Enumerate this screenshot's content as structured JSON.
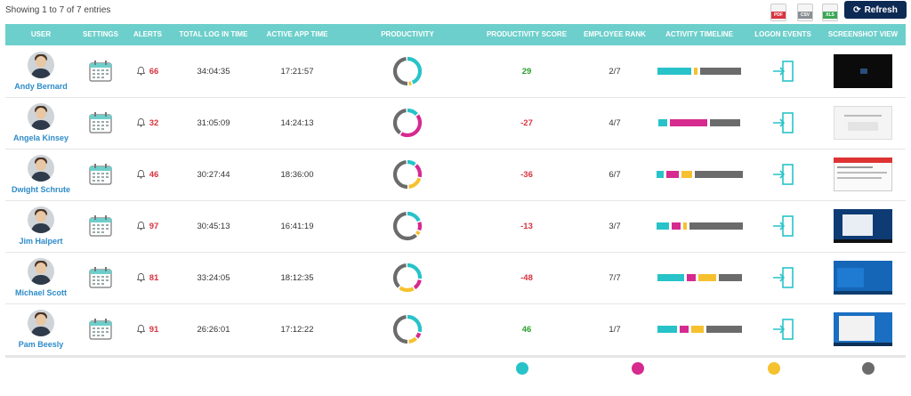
{
  "entries_text": "Showing 1 to 7 of 7 entries",
  "exports": [
    {
      "icon": "pdf-icon",
      "label": "PDF",
      "color": "#d9333f"
    },
    {
      "icon": "csv-icon",
      "label": "CSV",
      "color": "#8a8f95"
    },
    {
      "icon": "xls-icon",
      "label": "XLS",
      "color": "#3aa655"
    }
  ],
  "refresh_label": "Refresh",
  "columns": [
    "USER",
    "SETTINGS",
    "ALERTS",
    "TOTAL LOG IN TIME",
    "ACTIVE APP TIME",
    "PRODUCTIVITY",
    "PRODUCTIVITY SCORE",
    "EMPLOYEE RANK",
    "ACTIVITY TIMELINE",
    "LOGON EVENTS",
    "SCREENSHOT VIEW"
  ],
  "colors": {
    "header": "#6dcfcb",
    "teal": "#27c3c9",
    "magenta": "#d62a8f",
    "yellow": "#f6c12e",
    "gray": "#6b6b6b",
    "refresh": "#0d2a54"
  },
  "rows": [
    {
      "name": "Andy Bernard",
      "alerts": "66",
      "login": "34:04:35",
      "active": "17:21:57",
      "score": "29",
      "score_sign": "pos",
      "rank": "2/7",
      "productivity": [
        0.45,
        0.0,
        0.05,
        0.5
      ],
      "timeline": [
        {
          "c": "teal",
          "w": 38
        },
        {
          "c": "yellow",
          "w": 4
        },
        {
          "c": "gray",
          "w": 46
        }
      ],
      "screenshot": "dark"
    },
    {
      "name": "Angela Kinsey",
      "alerts": "32",
      "login": "31:05:09",
      "active": "14:24:13",
      "score": "-27",
      "score_sign": "neg",
      "rank": "4/7",
      "productivity": [
        0.15,
        0.45,
        0.0,
        0.4
      ],
      "timeline": [
        {
          "c": "teal",
          "w": 10
        },
        {
          "c": "magenta",
          "w": 42
        },
        {
          "c": "gray",
          "w": 34
        }
      ],
      "screenshot": "light"
    },
    {
      "name": "Dwight Schrute",
      "alerts": "46",
      "login": "30:27:44",
      "active": "18:36:00",
      "score": "-36",
      "score_sign": "neg",
      "rank": "6/7",
      "productivity": [
        0.12,
        0.18,
        0.2,
        0.5
      ],
      "timeline": [
        {
          "c": "teal",
          "w": 8
        },
        {
          "c": "magenta",
          "w": 14
        },
        {
          "c": "yellow",
          "w": 12
        },
        {
          "c": "gray",
          "w": 54
        }
      ],
      "screenshot": "browser"
    },
    {
      "name": "Jim Halpert",
      "alerts": "97",
      "login": "30:45:13",
      "active": "16:41:19",
      "score": "-13",
      "score_sign": "neg",
      "rank": "3/7",
      "productivity": [
        0.2,
        0.12,
        0.06,
        0.62
      ],
      "timeline": [
        {
          "c": "teal",
          "w": 14
        },
        {
          "c": "magenta",
          "w": 10
        },
        {
          "c": "yellow",
          "w": 4
        },
        {
          "c": "gray",
          "w": 60
        }
      ],
      "screenshot": "desktop"
    },
    {
      "name": "Michael Scott",
      "alerts": "81",
      "login": "33:24:05",
      "active": "18:12:35",
      "score": "-48",
      "score_sign": "neg",
      "rank": "7/7",
      "productivity": [
        0.28,
        0.14,
        0.2,
        0.38
      ],
      "timeline": [
        {
          "c": "teal",
          "w": 30
        },
        {
          "c": "magenta",
          "w": 10
        },
        {
          "c": "yellow",
          "w": 20
        },
        {
          "c": "gray",
          "w": 26
        }
      ],
      "screenshot": "blue"
    },
    {
      "name": "Pam Beesly",
      "alerts": "91",
      "login": "26:26:01",
      "active": "17:12:22",
      "score": "46",
      "score_sign": "pos",
      "rank": "1/7",
      "productivity": [
        0.3,
        0.08,
        0.12,
        0.5
      ],
      "timeline": [
        {
          "c": "teal",
          "w": 22
        },
        {
          "c": "magenta",
          "w": 10
        },
        {
          "c": "yellow",
          "w": 14
        },
        {
          "c": "gray",
          "w": 40
        }
      ],
      "screenshot": "windows"
    }
  ],
  "legend": [
    "teal",
    "magenta",
    "yellow",
    "gray"
  ]
}
